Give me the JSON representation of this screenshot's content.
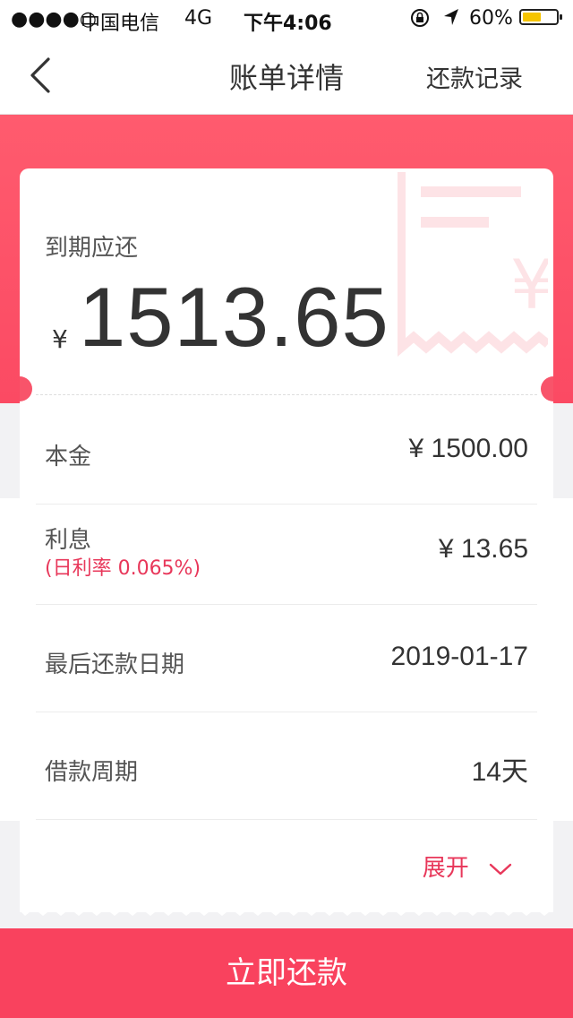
{
  "status_bar": {
    "signal": "●●●●○",
    "carrier": "中国电信",
    "network": "4G",
    "time": "下午4:06",
    "battery_text": "60%",
    "battery_level": 0.6,
    "battery_color": "#f5c400"
  },
  "nav": {
    "title": "账单详情",
    "right_action": "还款记录",
    "back_icon": "chevron-left-icon"
  },
  "summary": {
    "due_label": "到期应还",
    "currency_symbol": "¥",
    "amount": "1513.65"
  },
  "details": [
    {
      "label": "本金",
      "value": "¥ 1500.00"
    },
    {
      "label": "利息",
      "sub": "(日利率 0.065%)",
      "value": "¥ 13.65"
    },
    {
      "label": "最后还款日期",
      "value": "2019-01-17"
    },
    {
      "label": "借款周期",
      "value": "14天"
    }
  ],
  "expand": {
    "label": "展开",
    "icon": "chevron-down-icon"
  },
  "pay_button": {
    "label": "立即还款"
  },
  "colors": {
    "accent": "#f9425e",
    "accent_text": "#e8375a",
    "banner": "#fb4a63"
  }
}
